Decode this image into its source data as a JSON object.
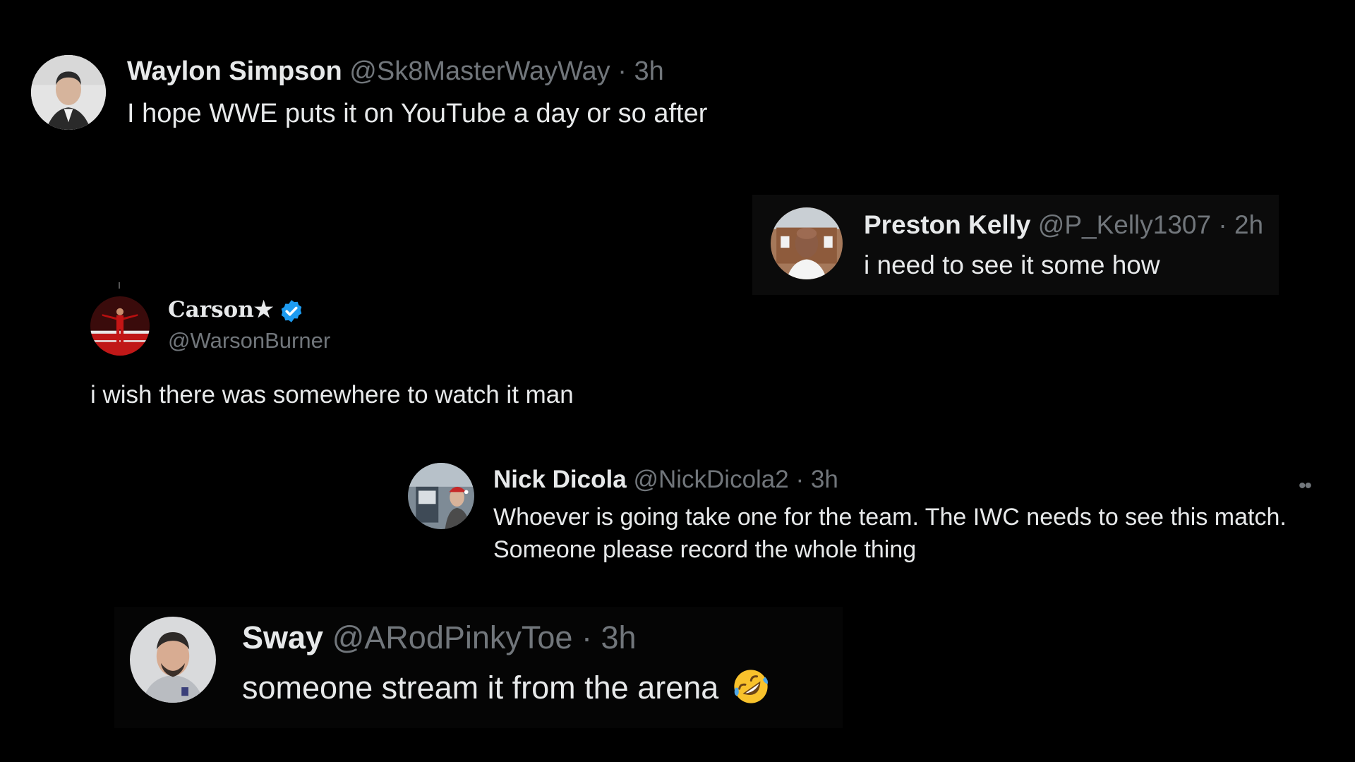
{
  "posts": [
    {
      "name": "Waylon Simpson",
      "handle": "@Sk8MasterWayWay",
      "separator": "·",
      "time": "3h",
      "text": "I hope WWE puts it on YouTube a day or so after"
    },
    {
      "name": "Preston Kelly",
      "handle": "@P_Kelly1307",
      "separator": "·",
      "time": "2h",
      "text": "i need to see it some how"
    },
    {
      "name": "Carson★",
      "handle": "@WarsonBurner",
      "verified_icon": "verified-badge-icon",
      "verified_color": "#1d9bf0",
      "text": "i wish there was somewhere to watch it man"
    },
    {
      "name": "Nick Dicola",
      "handle": "@NickDicola2",
      "separator": "·",
      "time": "3h",
      "text_line1": "Whoever is going take one for the team. The IWC needs to see this match.",
      "text_line2": "Someone please record the whole thing",
      "more_icon": "more-options-icon"
    },
    {
      "name": "Sway",
      "handle": "@ARodPinkyToe",
      "separator": "·",
      "time": "3h",
      "text": "someone stream it from the arena",
      "emoji_icon": "rolling-on-floor-laughing-emoji-icon"
    }
  ],
  "colors": {
    "background": "#000000",
    "text_primary": "#e7e9ea",
    "text_secondary": "#71767b"
  }
}
